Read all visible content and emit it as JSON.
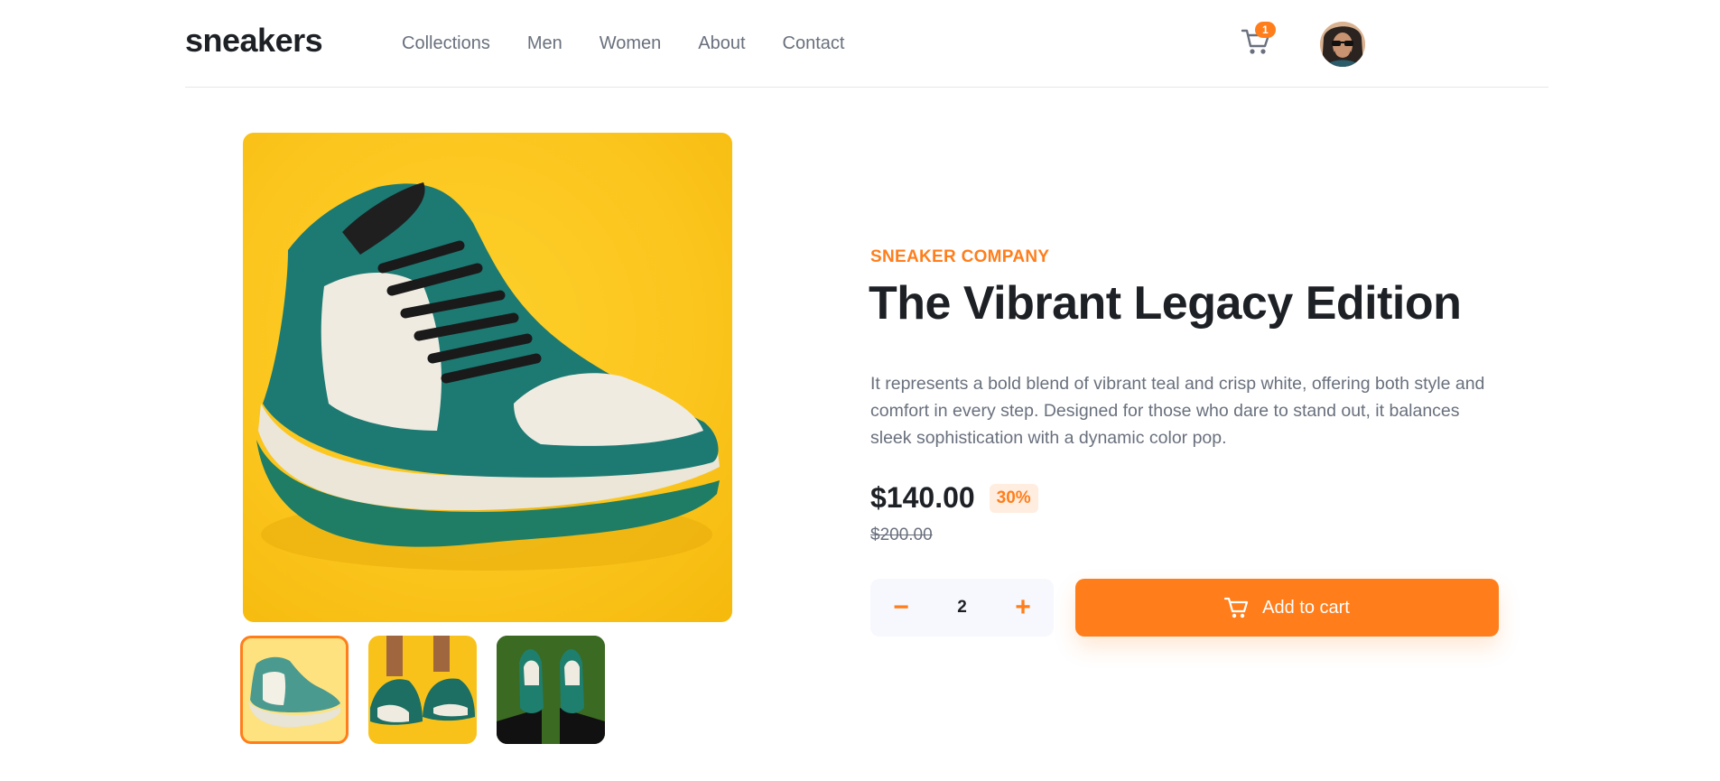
{
  "brand": {
    "logo": "sneakers"
  },
  "nav": {
    "items": [
      "Collections",
      "Men",
      "Women",
      "About",
      "Contact"
    ]
  },
  "cart": {
    "badge_count": "1",
    "icon": "cart-icon"
  },
  "user": {
    "avatar": "avatar"
  },
  "gallery": {
    "main_image": "teal-white-sneaker-on-yellow",
    "thumbnails": [
      "sneaker-on-light-yellow",
      "sneakers-worn-on-yellow",
      "sneakers-worn-on-grass"
    ],
    "selected_index": 0
  },
  "product": {
    "company": "SNEAKER COMPANY",
    "title": "The Vibrant Legacy Edition",
    "description": "It represents a bold blend of vibrant teal and crisp white, offering both style and comfort in every step. Designed for those who dare to stand out, it balances sleek sophistication with a dynamic color pop.",
    "price": "$140.00",
    "discount": "30%",
    "original_price": "$200.00"
  },
  "quantity": {
    "value": "2",
    "decrement_label": "−",
    "increment_label": "+"
  },
  "actions": {
    "add_to_cart_label": "Add to cart"
  },
  "colors": {
    "accent": "#ff7e1b",
    "accent_light": "#ffede0",
    "text_dark": "#1d2025",
    "text_muted": "#69707d",
    "teal": "#1e7d72",
    "yellow": "#fbc51d"
  }
}
